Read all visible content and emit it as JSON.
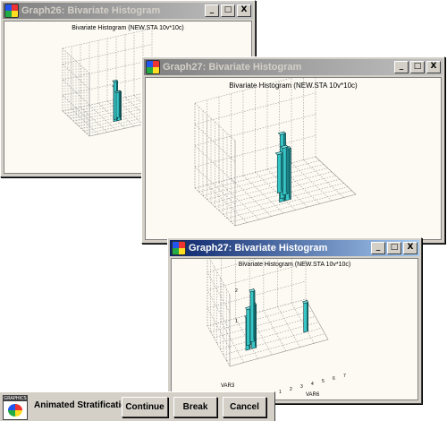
{
  "windows": {
    "graph26": {
      "title": "Graph26: Bivariate Histogram",
      "graph_title": "Bivariate Histogram (NEW.STA 10v*10c)"
    },
    "graph27_top": {
      "title": "Graph27: Bivariate Histogram",
      "graph_title": "Bivariate Histogram (NEW.STA 10v*10c)"
    },
    "graph27_front": {
      "title": "Graph27: Bivariate Histogram",
      "graph_title": "Bivariate Histogram (NEW.STA 10v*10c)",
      "axis_labels": {
        "vertical_ticks": [
          "2",
          "1"
        ],
        "x_axis": "VAR6",
        "y_axis": "VAR3",
        "x_ticks": [
          "1",
          "2",
          "3",
          "4",
          "5",
          "6",
          "7"
        ]
      }
    }
  },
  "controls": {
    "minimize": "_",
    "maximize": "□",
    "close": "X"
  },
  "toolbar": {
    "icon_tag": "GRAPHICS",
    "label": "Animated Stratification:",
    "continue_label": "Continue",
    "break_label": "Break",
    "cancel_label": "Cancel"
  },
  "colors": {
    "bar_face": "#37c6c6",
    "bar_side": "#1e8f95",
    "bar_top": "#7ee4e4",
    "title_active": "#0a246a",
    "title_inactive": "#808080"
  },
  "chart_data": [
    {
      "type": "bar",
      "title": "Bivariate Histogram (NEW.STA 10v*10c)"
    },
    {
      "type": "bar",
      "title": "Bivariate Histogram (NEW.STA 10v*10c)"
    },
    {
      "type": "bar",
      "title": "Bivariate Histogram (NEW.STA 10v*10c)",
      "xlabel": "VAR6",
      "ylabel": "VAR3"
    }
  ]
}
